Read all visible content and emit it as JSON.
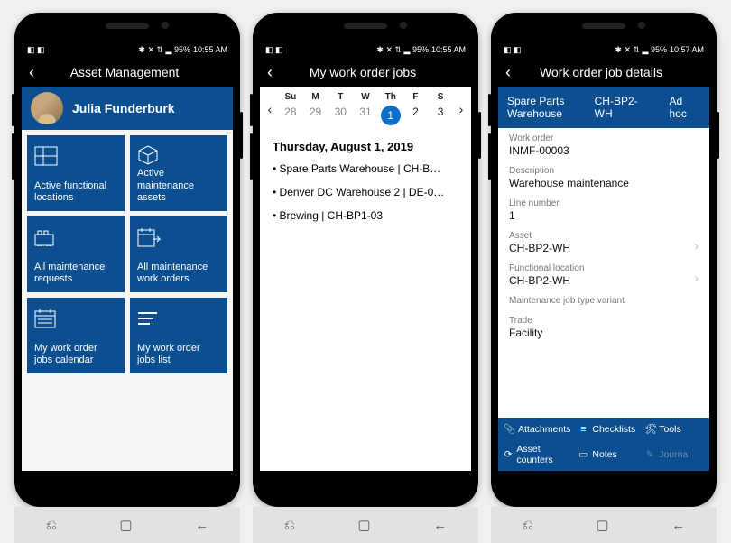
{
  "status": {
    "left": "◧ ◧",
    "icons": "✱ ✕ ⇅ ▂ 95%",
    "time1": "10:55 AM",
    "time2": "10:55 AM",
    "time3": "10:57 AM"
  },
  "screen1": {
    "title": "Asset Management",
    "user": "Julia Funderburk",
    "tiles": [
      {
        "label": "Active functional locations"
      },
      {
        "label": "Active maintenance assets"
      },
      {
        "label": "All maintenance requests"
      },
      {
        "label": "All maintenance work orders"
      },
      {
        "label": "My work order jobs calendar"
      },
      {
        "label": "My work order jobs list"
      }
    ]
  },
  "screen2": {
    "title": "My work order jobs",
    "dow": [
      "Su",
      "M",
      "T",
      "W",
      "Th",
      "F",
      "S"
    ],
    "days": [
      "28",
      "29",
      "30",
      "31",
      "1",
      "2",
      "3"
    ],
    "selectedIndex": 4,
    "date_heading": "Thursday, August 1, 2019",
    "jobs": [
      "Spare Parts Warehouse | CH-B…",
      "Denver DC Warehouse 2 | DE-0…",
      "Brewing | CH-BP1-03"
    ]
  },
  "screen3": {
    "title": "Work order job details",
    "headcols": [
      "Spare Parts Warehouse",
      "CH-BP2-WH",
      "Ad hoc"
    ],
    "fields": [
      {
        "lab": "Work order",
        "val": "INMF-00003"
      },
      {
        "lab": "Description",
        "val": "Warehouse maintenance"
      },
      {
        "lab": "Line number",
        "val": "1"
      },
      {
        "lab": "Asset",
        "val": "CH-BP2-WH",
        "chevron": true
      },
      {
        "lab": "Functional location",
        "val": "CH-BP2-WH",
        "chevron": true
      },
      {
        "lab": "Maintenance job type variant",
        "val": ""
      },
      {
        "lab": "Trade",
        "val": "Facility"
      }
    ],
    "actions": [
      {
        "icon": "📎",
        "label": "Attachments"
      },
      {
        "icon": "≡",
        "label": "Checklists"
      },
      {
        "icon": "🛠",
        "label": "Tools"
      },
      {
        "icon": "⟳",
        "label": "Asset counters"
      },
      {
        "icon": "▭",
        "label": "Notes"
      },
      {
        "icon": "✎",
        "label": "Journal",
        "dim": true
      }
    ]
  }
}
